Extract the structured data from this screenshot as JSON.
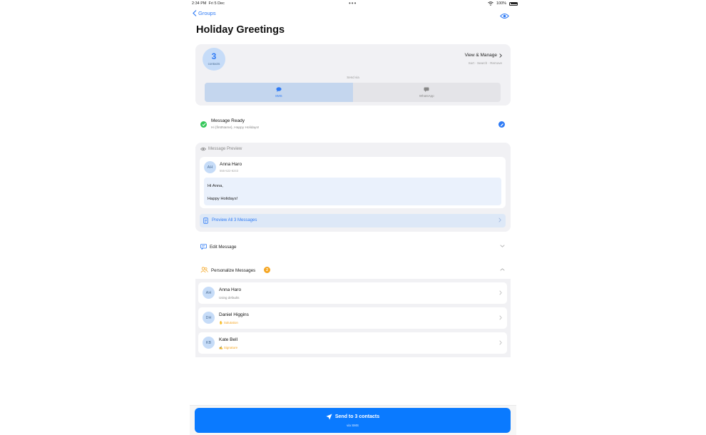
{
  "status": {
    "time": "2:34 PM",
    "date": "Fri 5 Dec",
    "battery": "100%"
  },
  "nav": {
    "back_label": "Groups"
  },
  "page_title": "Holiday Greetings",
  "summary": {
    "count": "3",
    "count_label": "contacts",
    "view_manage": "View & Manage",
    "view_manage_sub": "Sort · Search · Remove",
    "send_via": "Send via",
    "channels": [
      "SMS",
      "WhatsApp"
    ],
    "selected_channel": "SMS"
  },
  "ready": {
    "title": "Message Ready",
    "subtitle": "Hi {firstName}, Happy Holidays!"
  },
  "preview": {
    "header": "Message Preview",
    "contact_initials": "AH",
    "contact_name": "Anna Haro",
    "contact_phone": "555-522-8243",
    "line1": "Hi Anna,",
    "line2": "Happy Holidays!",
    "preview_all": "Preview All 3 Messages"
  },
  "edit": {
    "label": "Edit Message"
  },
  "personalize": {
    "label": "Personalize Messages",
    "badge": "2",
    "contacts": [
      {
        "initials": "AH",
        "name": "Anna Haro",
        "status": "Using defaults",
        "custom": false
      },
      {
        "initials": "DH",
        "name": "Daniel Higgins",
        "status": "Salutation",
        "custom": true
      },
      {
        "initials": "KB",
        "name": "Kate Bell",
        "status": "Signature",
        "custom": true
      }
    ]
  },
  "send": {
    "label": "Send to 3 contacts",
    "sub": "via SMS"
  },
  "colors": {
    "accent": "#2f7bf5",
    "button": "#0a7aff",
    "success": "#34c759",
    "warning": "#f5a623"
  }
}
